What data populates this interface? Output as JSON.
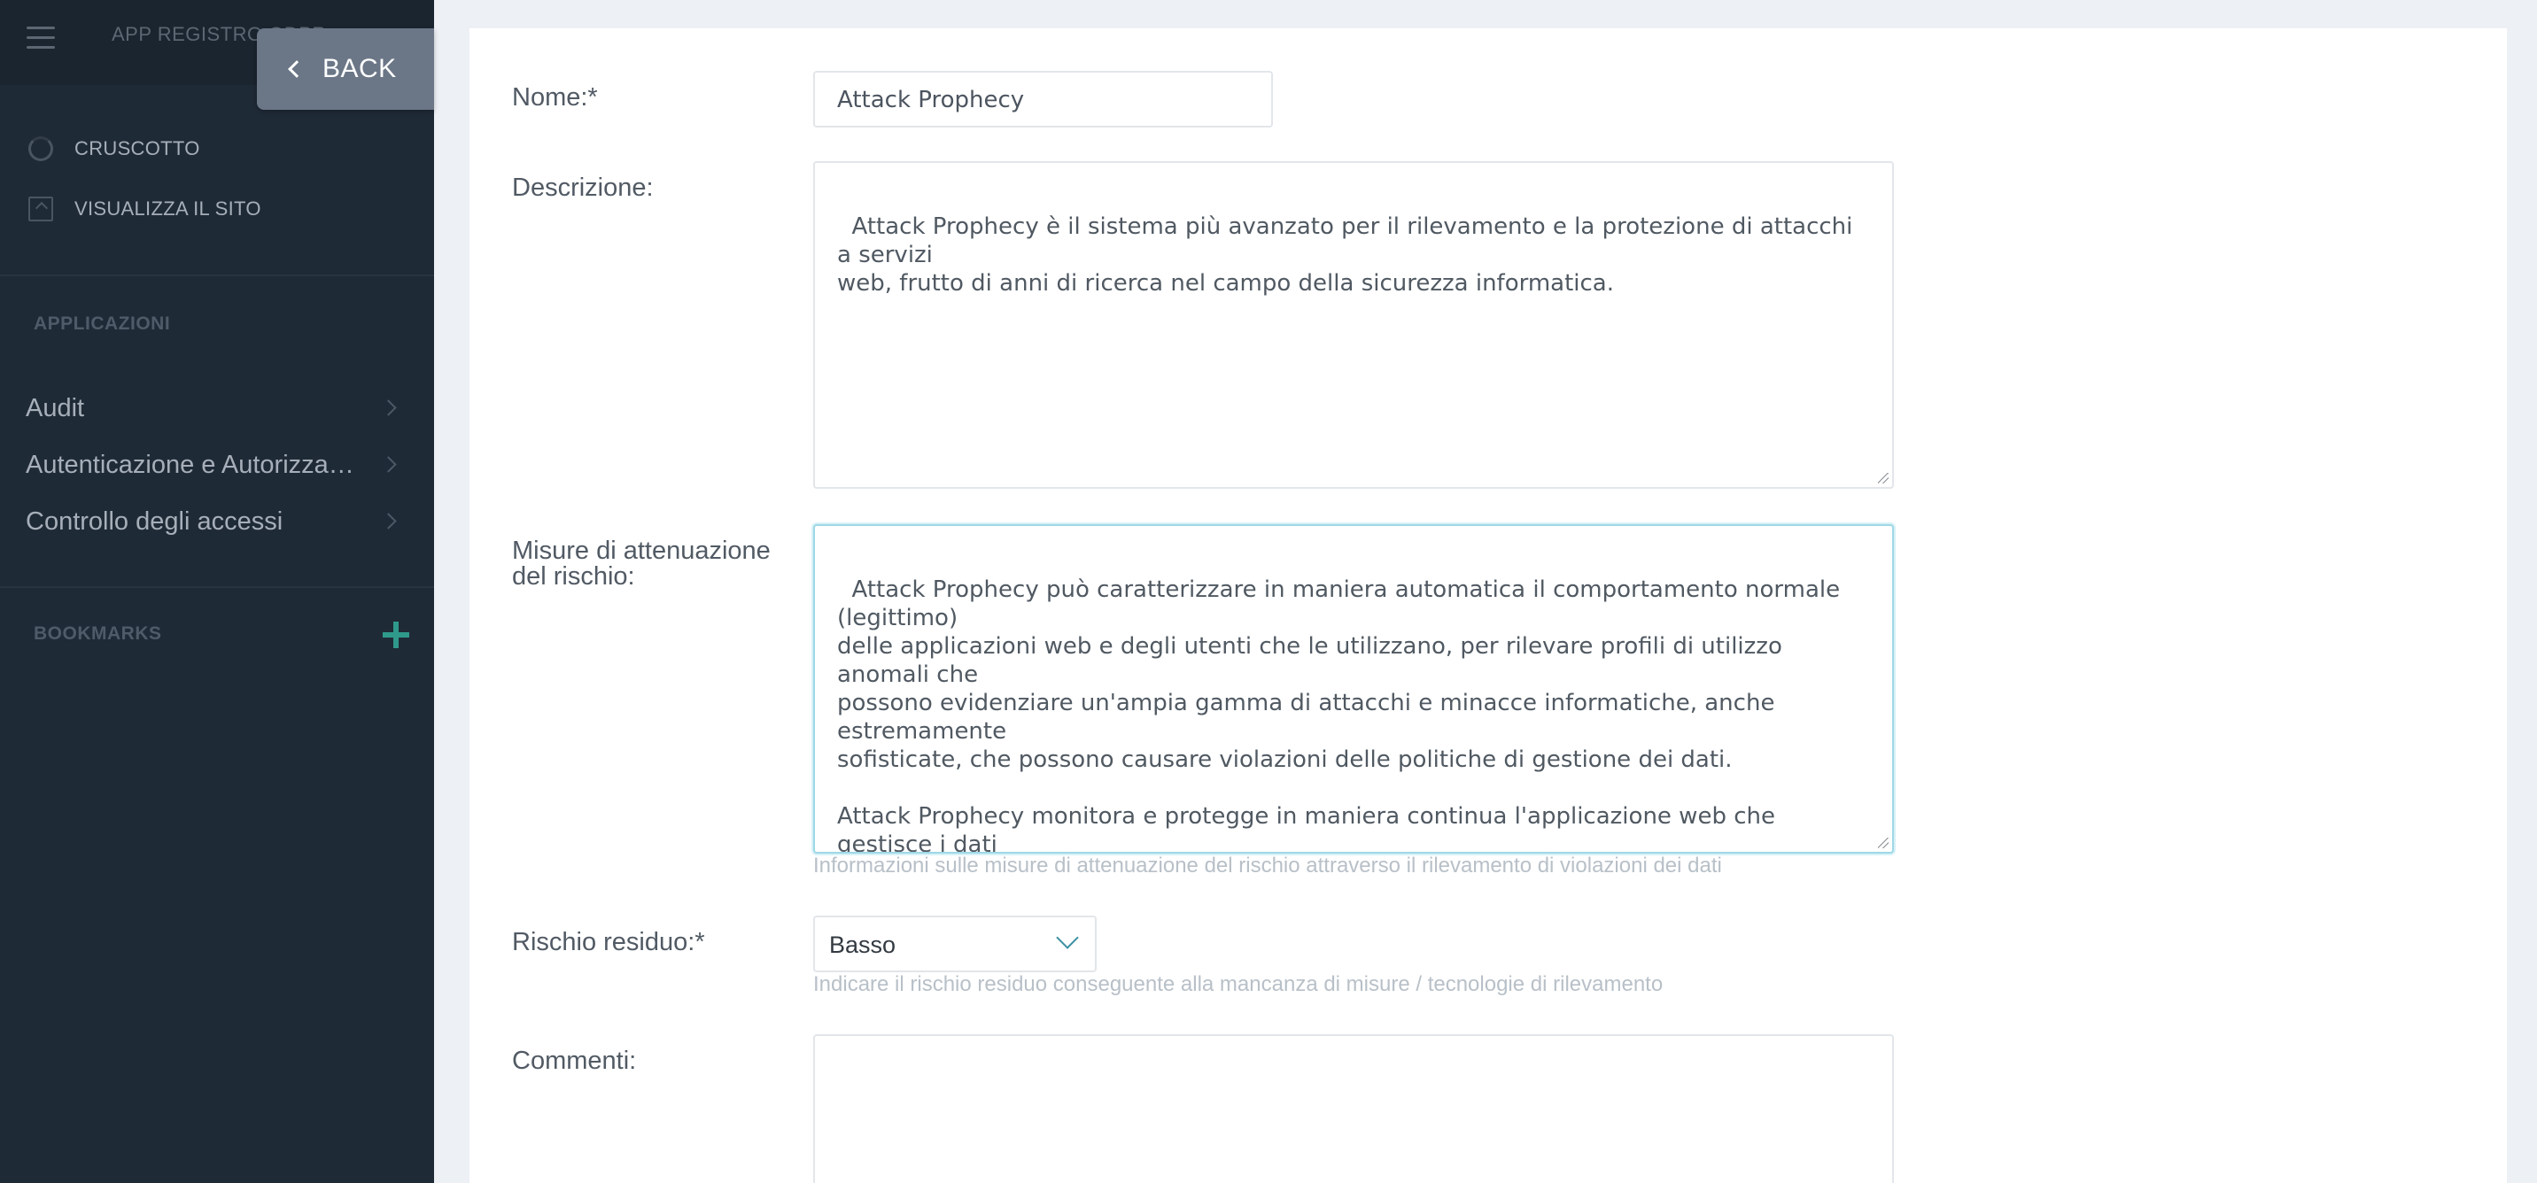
{
  "sidebar": {
    "app_title": "APP REGISTRO GDPR",
    "back_label": "BACK",
    "links": [
      {
        "label": "CRUSCOTTO",
        "icon": "dashboard-icon"
      },
      {
        "label": "VISUALIZZA IL SITO",
        "icon": "view-site-icon"
      }
    ],
    "applications_header": "APPLICAZIONI",
    "apps": [
      {
        "label": "Audit"
      },
      {
        "label": "Autenticazione e Autorizzazione"
      },
      {
        "label": "Controllo degli accessi"
      }
    ],
    "bookmarks_header": "BOOKMARKS"
  },
  "form": {
    "name_label": "Nome:*",
    "name_value": "Attack Prophecy",
    "description_label": "Descrizione:",
    "description_value": "Attack Prophecy è il sistema più avanzato per il rilevamento e la protezione di attacchi a servizi\nweb, frutto di anni di ricerca nel campo della sicurezza informatica.",
    "mitigation_label": "Misure di attenuazione\ndel rischio:",
    "mitigation_value": "Attack Prophecy può caratterizzare in maniera automatica il comportamento normale (legittimo)\ndelle applicazioni web e degli utenti che le utilizzano, per rilevare profili di utilizzo anomali che\npossono evidenziare un'ampia gamma di attacchi e minacce informatiche, anche estremamente\nsofisticate, che possono causare violazioni delle politiche di gestione dei dati.\n\nAttack Prophecy monitora e protegge in maniera continua l'applicazione web che gestisce i dati\ndel personale.",
    "mitigation_help": "Informazioni sulle misure di attenuazione del rischio attraverso il rilevamento di violazioni dei dati",
    "residual_label": "Rischio residuo:*",
    "residual_value": "Basso",
    "residual_help": "Indicare il rischio residuo conseguente alla mancanza di misure / tecnologie di rilevamento",
    "comments_label": "Commenti:",
    "comments_value": ""
  },
  "colors": {
    "sidebar_bg": "#1f2a37",
    "accent": "#2f9a8b",
    "focus_border": "#9ed8e6"
  }
}
